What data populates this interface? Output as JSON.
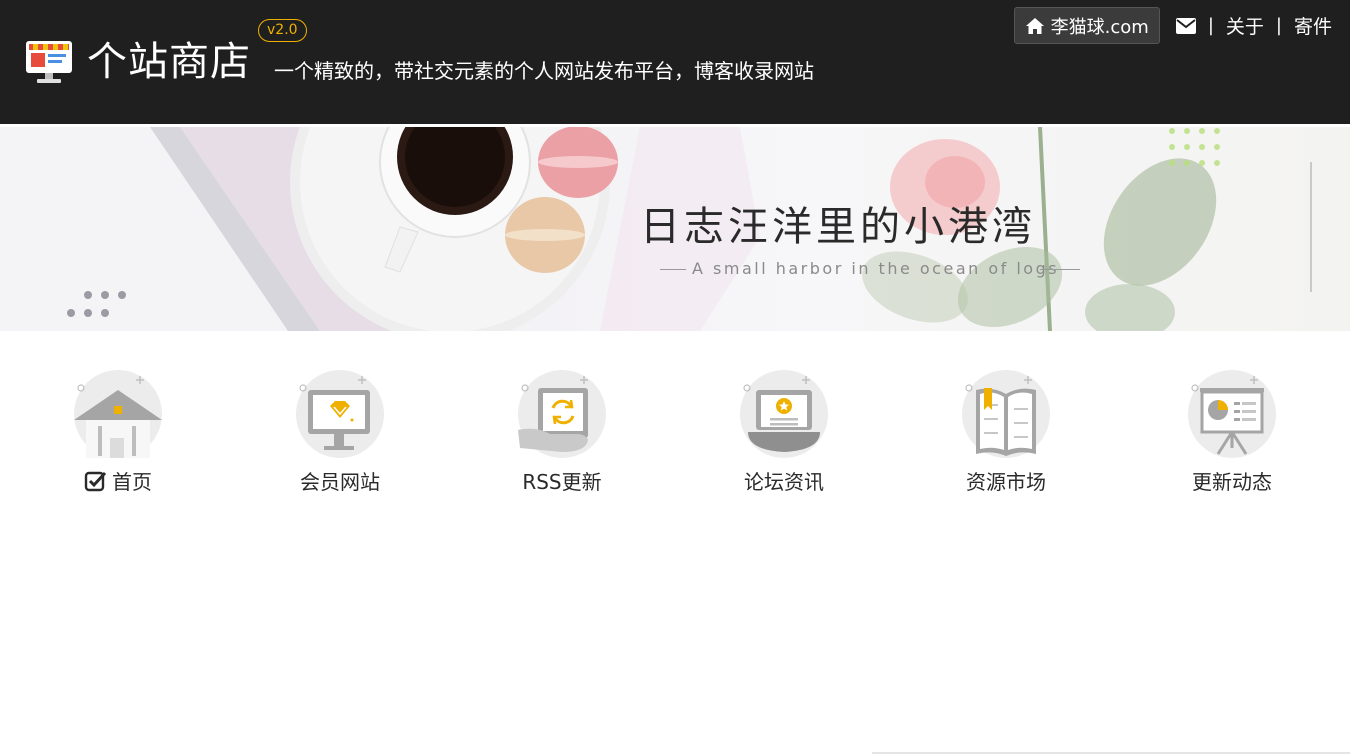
{
  "header": {
    "site_title": "个站商店",
    "version": "v2.0",
    "slogan": "一个精致的，带社交元素的个人网站发布平台，博客收录网站",
    "nav": {
      "home_label": "李猫球.com",
      "separator": "|",
      "about_label": "关于",
      "submit_label": "寄件"
    },
    "icons": [
      "monitor-shop-icon",
      "home-icon",
      "mail-icon"
    ]
  },
  "banner": {
    "title": "日志汪洋里的小港湾",
    "subtitle": "A small harbor in the ocean of logs"
  },
  "categories": [
    {
      "label": "首页",
      "icon": "house-icon",
      "active": true
    },
    {
      "label": "会员网站",
      "icon": "monitor-diamond-icon",
      "active": false
    },
    {
      "label": "RSS更新",
      "icon": "tablet-refresh-icon",
      "active": false
    },
    {
      "label": "论坛资讯",
      "icon": "laptop-star-icon",
      "active": false
    },
    {
      "label": "资源市场",
      "icon": "open-book-icon",
      "active": false
    },
    {
      "label": "更新动态",
      "icon": "presentation-board-icon",
      "active": false
    }
  ],
  "colors": {
    "header_bg": "#1f1f1f",
    "accent": "#f0b000",
    "icon_gray": "#9a9a9a",
    "icon_circle": "#ececec"
  }
}
